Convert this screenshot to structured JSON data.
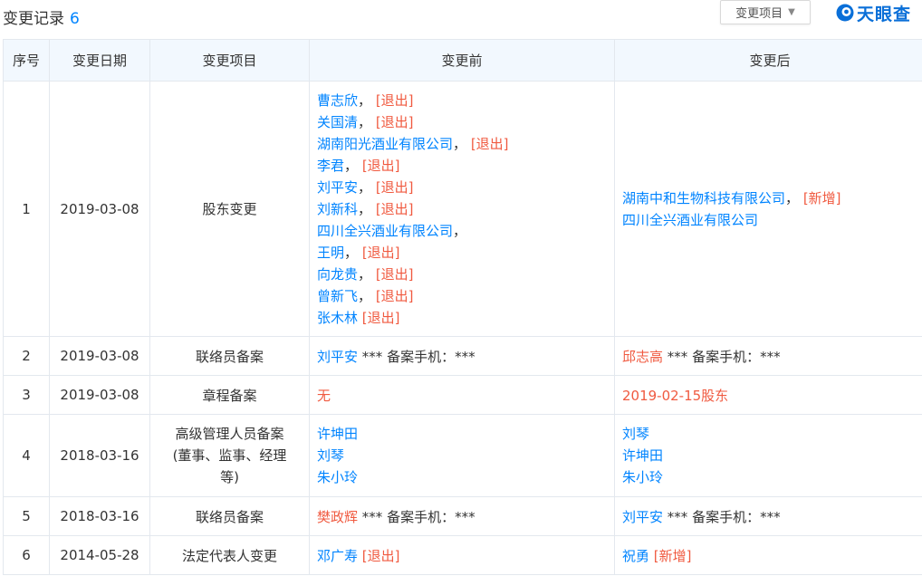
{
  "header": {
    "title": "变更记录",
    "count": "6",
    "filter_label": "变更项目",
    "logo_text": "天眼查"
  },
  "columns": [
    "序号",
    "变更日期",
    "变更项目",
    "变更前",
    "变更后"
  ],
  "tags": {
    "quit": "[退出]",
    "new": "[新增]"
  },
  "phone_suffix": "*** 备案手机：***",
  "rows": [
    {
      "index": "1",
      "date": "2019-03-08",
      "item": "股东变更",
      "before": [
        {
          "name": "曹志欣",
          "sep": "，",
          "tag": "[退出]"
        },
        {
          "name": "关国清",
          "sep": "，",
          "tag": "[退出]"
        },
        {
          "name": "湖南阳光酒业有限公司",
          "sep": "，",
          "tag": "[退出]"
        },
        {
          "name": "李君",
          "sep": "，",
          "tag": "[退出]"
        },
        {
          "name": "刘平安",
          "sep": "，",
          "tag": "[退出]"
        },
        {
          "name": "刘新科",
          "sep": "，",
          "tag": "[退出]"
        },
        {
          "name": "四川全兴酒业有限公司",
          "sep": "，",
          "tag": ""
        },
        {
          "name": "王明",
          "sep": "，",
          "tag": "[退出]"
        },
        {
          "name": "向龙贵",
          "sep": "，",
          "tag": "[退出]"
        },
        {
          "name": "曾新飞",
          "sep": "，",
          "tag": "[退出]"
        },
        {
          "name": "张木林",
          "sep": "",
          "tag": "[退出]"
        }
      ],
      "after": [
        {
          "name": "湖南中和生物科技有限公司",
          "sep": "，",
          "tag": "[新增]"
        },
        {
          "name": "四川全兴酒业有限公司",
          "sep": "",
          "tag": ""
        }
      ]
    },
    {
      "index": "2",
      "date": "2019-03-08",
      "item": "联络员备案",
      "before_name": "刘平安",
      "before_suffix": "*** 备案手机：***",
      "after_name": "邱志高",
      "after_suffix": "*** 备案手机：***"
    },
    {
      "index": "3",
      "date": "2019-03-08",
      "item": "章程备案",
      "before_text": "无",
      "after_text": "2019-02-15股东"
    },
    {
      "index": "4",
      "date": "2018-03-16",
      "item_lines": [
        "高级管理人员备案",
        "(董事、监事、经理",
        "等)"
      ],
      "before_lines": [
        "许坤田",
        "刘琴",
        "朱小玲"
      ],
      "after_lines": [
        "刘琴",
        "许坤田",
        "朱小玲"
      ]
    },
    {
      "index": "5",
      "date": "2018-03-16",
      "item": "联络员备案",
      "before_name": "樊政辉",
      "before_suffix": "*** 备案手机：***",
      "after_name": "刘平安",
      "after_suffix": "*** 备案手机：***"
    },
    {
      "index": "6",
      "date": "2014-05-28",
      "item": "法定代表人变更",
      "before_name": "邓广寿",
      "before_tag": "[退出]",
      "after_name": "祝勇",
      "after_tag": "[新增]"
    }
  ],
  "colors": {
    "link": "#0084ff",
    "tag": "#f05a40",
    "header_bg": "#f2f8fe",
    "border": "#e3e8ee"
  }
}
